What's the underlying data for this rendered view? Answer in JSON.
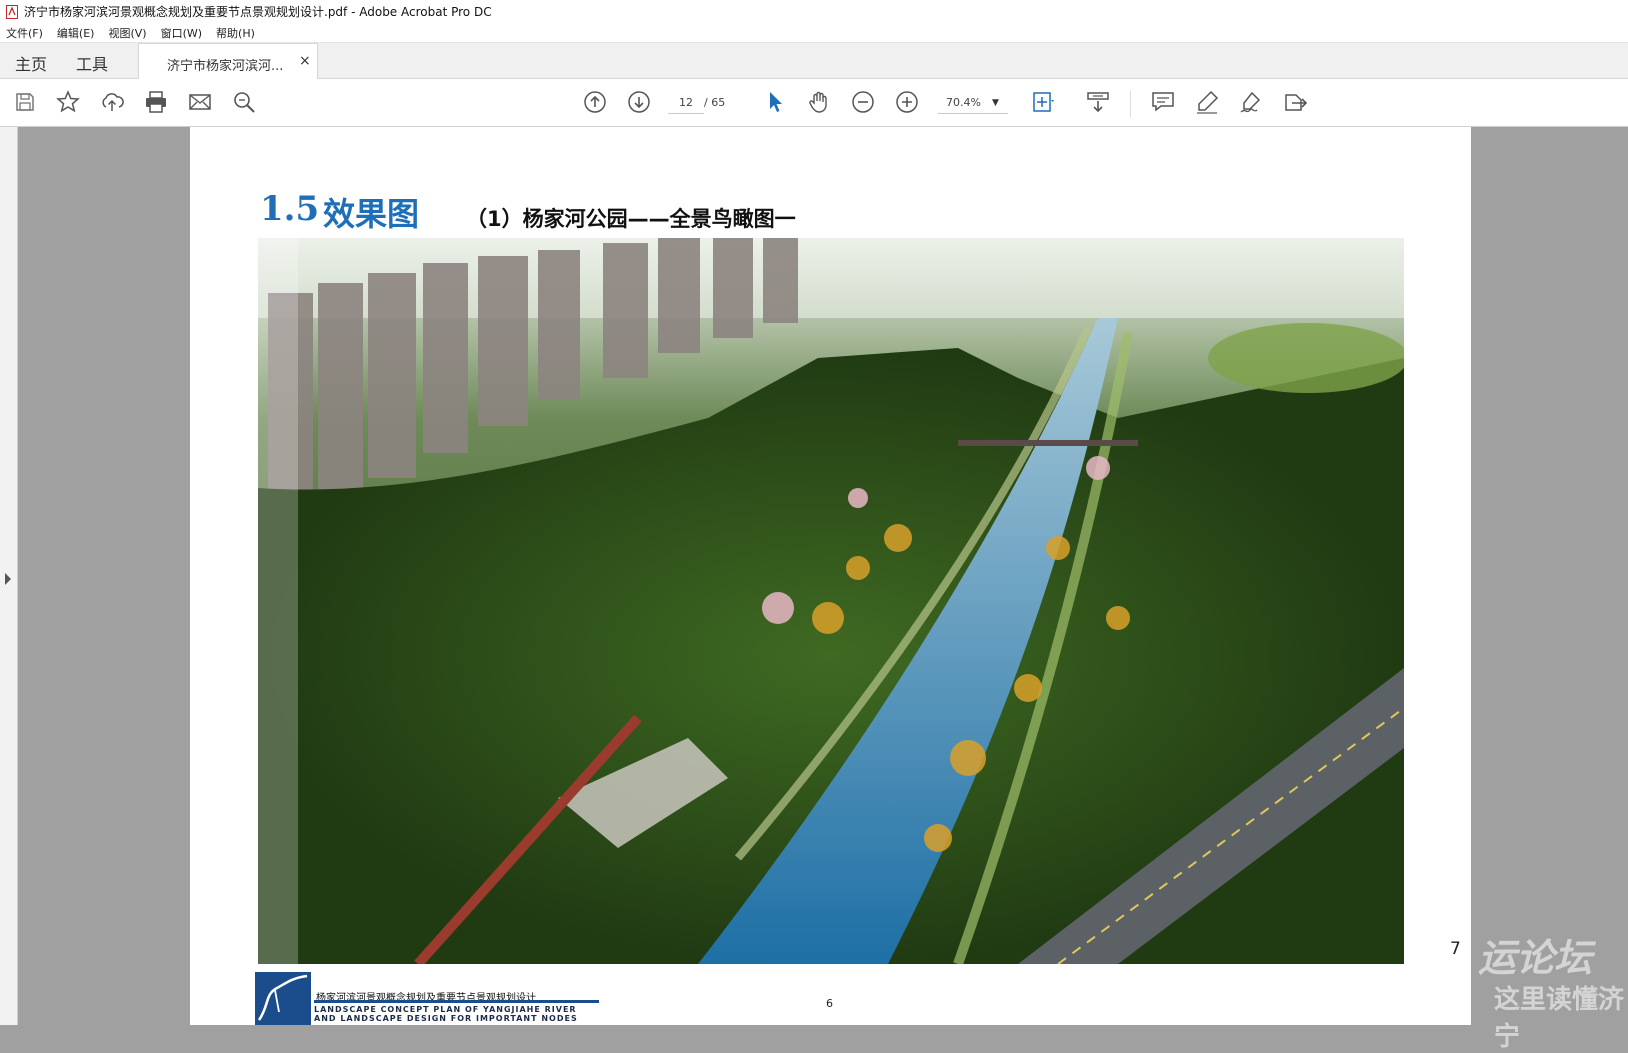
{
  "window": {
    "title": "济宁市杨家河滨河景观概念规划及重要节点景观规划设计.pdf - Adobe Acrobat Pro DC"
  },
  "menu": {
    "items": [
      "文件(F)",
      "编辑(E)",
      "视图(V)",
      "窗口(W)",
      "帮助(H)"
    ]
  },
  "tabs": {
    "home": "主页",
    "tools": "工具",
    "document": "济宁市杨家河滨河...",
    "close": "×"
  },
  "toolbar": {
    "icons": [
      "save-icon",
      "bookmark-star-icon",
      "upload-cloud-icon",
      "print-icon",
      "email-icon",
      "search-zoom-icon",
      "page-up-icon",
      "page-down-icon",
      "select-arrow-icon",
      "hand-tool-icon",
      "zoom-out-icon",
      "zoom-in-icon",
      "fit-page-icon",
      "scroll-mode-icon",
      "comment-icon",
      "highlight-pen-icon",
      "sign-icon",
      "share-icon"
    ],
    "current_page": "12",
    "total_pages": "/ 65",
    "zoom": "70.4%"
  },
  "document": {
    "heading_number": "1.5",
    "heading_title": "效果图",
    "subheading": "（1）杨家河公园——全景鸟瞰图一",
    "footer_cn": "杨家河滨河景观概念规划及重要节点景观规划设计",
    "footer_en_1": "LANDSCAPE CONCEPT PLAN OF YANGJIAHE RIVER",
    "footer_en_2": "AND LANDSCAPE DESIGN FOR IMPORTANT NODES",
    "page_number": "6",
    "side_number": "7"
  },
  "watermark": {
    "line1": "运论坛",
    "line2": "这里读懂济宁"
  },
  "colors": {
    "accent": "#1f6fb8",
    "toolbar_bg": "#ffffff",
    "canvas_bg": "#a0a0a0"
  }
}
